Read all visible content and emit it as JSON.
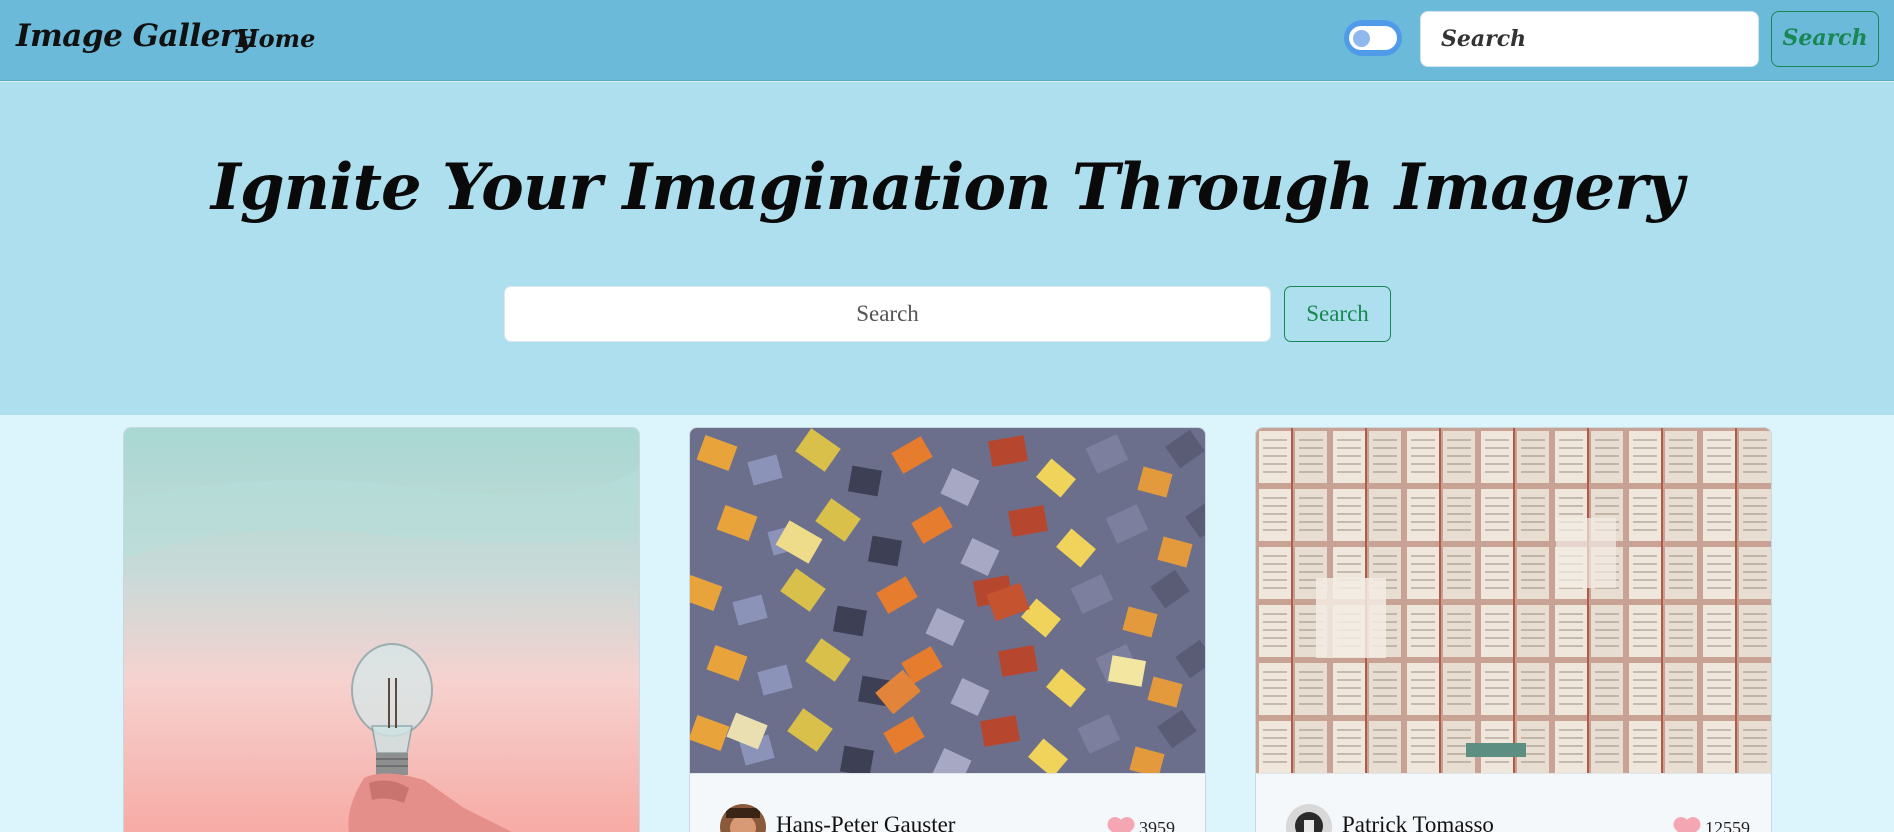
{
  "navbar": {
    "brand": "Image Gallery",
    "home_label": "Home",
    "search_placeholder": "Search",
    "search_button": "Search"
  },
  "hero": {
    "title": "Ignite Your Imagination Through Imagery",
    "search_placeholder": "Search",
    "search_button": "Search"
  },
  "cards": [
    {
      "author": "",
      "likes": "",
      "image": "lightbulb-image"
    },
    {
      "author": "Hans-Peter Gauster",
      "likes": "3959",
      "image": "puzzle-pieces-image"
    },
    {
      "author": "Patrick Tomasso",
      "likes": "12559",
      "image": "open-books-image"
    }
  ],
  "colors": {
    "navbar_bg": "#6cbad9",
    "hero_bg": "#aedfef",
    "page_bg": "#dcf4fc",
    "accent_green": "#198754",
    "heart": "#f4a6b3"
  }
}
